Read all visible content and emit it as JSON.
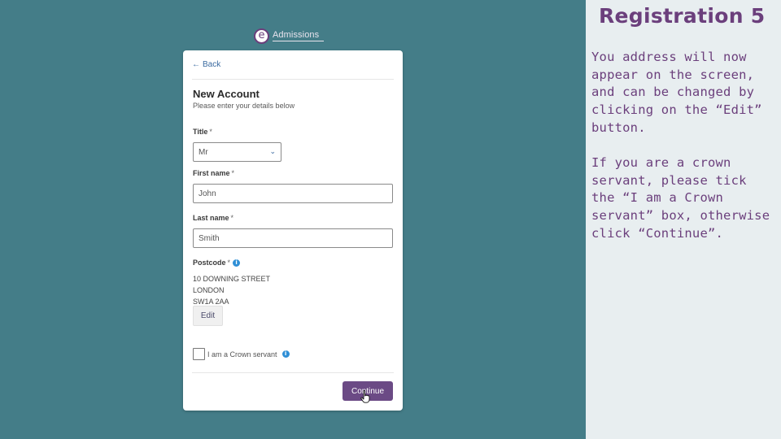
{
  "logo": {
    "glyph": "e",
    "text": "Admissions"
  },
  "form": {
    "back_label": "Back",
    "title": "New Account",
    "subtitle": "Please enter your details below",
    "title_field": {
      "label": "Title",
      "required_mark": "*",
      "value": "Mr"
    },
    "first_name": {
      "label": "First name",
      "required_mark": "*",
      "value": "John"
    },
    "last_name": {
      "label": "Last name",
      "required_mark": "*",
      "value": "Smith"
    },
    "postcode": {
      "label": "Postcode",
      "required_mark": "*",
      "address_lines": [
        "10 DOWNING STREET",
        "LONDON",
        "SW1A 2AA"
      ]
    },
    "edit_label": "Edit",
    "crown_servant_label": "I am a Crown servant",
    "crown_servant_checked": false,
    "continue_label": "Continue"
  },
  "panel": {
    "title": "Registration 5",
    "paragraph1": "You address will now appear on the screen, and can be changed by clicking on the “Edit” button.",
    "paragraph2": "If you are a crown servant, please tick the “I am a Crown servant” box, otherwise click “Continue”."
  },
  "colors": {
    "background": "#447d88",
    "accent_purple": "#6b3f7c",
    "button_purple": "#6b4a85",
    "link_blue": "#3a6aa0",
    "info_blue": "#2f8fd6",
    "panel_bg": "#e8eef0"
  },
  "icons": {
    "back": "arrow-left-icon",
    "dropdown": "chevron-down-icon",
    "info": "info-icon",
    "cursor": "hand-pointer-icon"
  }
}
